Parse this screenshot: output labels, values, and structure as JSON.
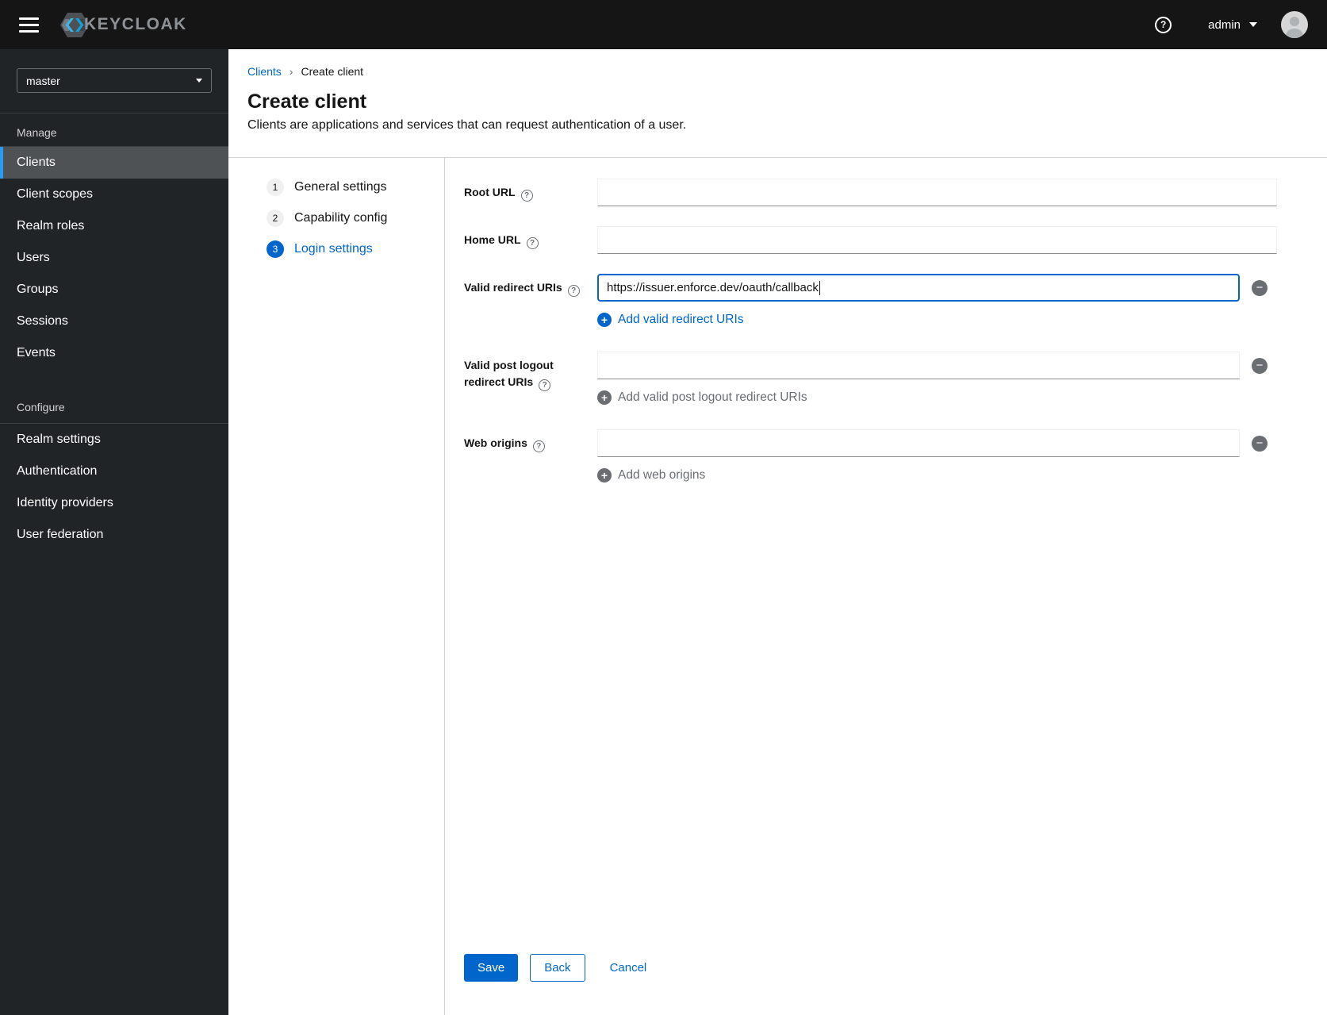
{
  "masthead": {
    "brand": "KEYCLOAK",
    "username": "admin"
  },
  "icons": {
    "help": "?",
    "add": "+",
    "remove": "−",
    "breadcrumb_separator": "›"
  },
  "sidebar": {
    "realm_selector": {
      "value": "master"
    },
    "sections": [
      {
        "title": "Manage",
        "items": [
          {
            "label": "Clients",
            "active": true
          },
          {
            "label": "Client scopes"
          },
          {
            "label": "Realm roles"
          },
          {
            "label": "Users"
          },
          {
            "label": "Groups"
          },
          {
            "label": "Sessions"
          },
          {
            "label": "Events"
          }
        ]
      },
      {
        "title": "Configure",
        "items": [
          {
            "label": "Realm settings"
          },
          {
            "label": "Authentication"
          },
          {
            "label": "Identity providers"
          },
          {
            "label": "User federation"
          }
        ]
      }
    ]
  },
  "breadcrumb": {
    "items": [
      {
        "label": "Clients"
      },
      {
        "label": "Create client"
      }
    ]
  },
  "page": {
    "title": "Create client",
    "description": "Clients are applications and services that can request authentication of a user."
  },
  "wizard": {
    "steps": [
      {
        "number": "1",
        "label": "General settings",
        "current": false
      },
      {
        "number": "2",
        "label": "Capability config",
        "current": false
      },
      {
        "number": "3",
        "label": "Login settings",
        "current": true
      }
    ]
  },
  "form": {
    "root_url": {
      "label": "Root URL",
      "value": ""
    },
    "home_url": {
      "label": "Home URL",
      "value": ""
    },
    "valid_redirect_uris": {
      "label": "Valid redirect URIs",
      "value": "https://issuer.enforce.dev/oauth/callback",
      "add_label": "Add valid redirect URIs",
      "add_enabled": true
    },
    "post_logout_redirect_uris": {
      "label": "Valid post logout redirect URIs",
      "value": "",
      "add_label": "Add valid post logout redirect URIs",
      "add_enabled": false
    },
    "web_origins": {
      "label": "Web origins",
      "value": "",
      "add_label": "Add web origins",
      "add_enabled": false
    }
  },
  "actions": {
    "save": "Save",
    "back": "Back",
    "cancel": "Cancel"
  },
  "colors": {
    "accent": "#0066cc",
    "masthead_bg": "#151515",
    "sidebar_bg": "#212427",
    "sidebar_active_bg": "#4f5255",
    "sidebar_active_border": "#2b9af3",
    "divider": "#d2d2d2",
    "muted": "#6a6e73"
  }
}
